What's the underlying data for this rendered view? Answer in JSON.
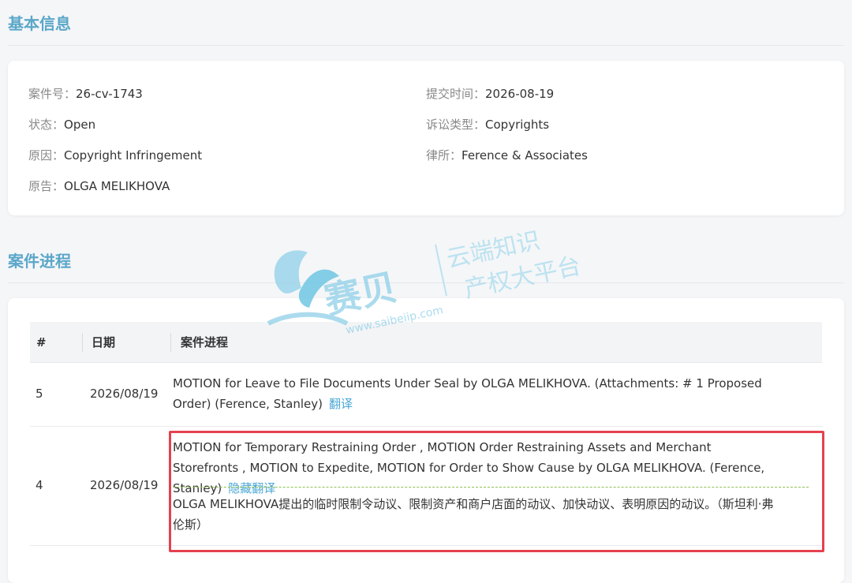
{
  "basic_info": {
    "title": "基本信息",
    "fields": [
      {
        "label": "案件号：",
        "value": "26-cv-1743"
      },
      {
        "label": "提交时间：",
        "value": "2026-08-19"
      },
      {
        "label": "状态：",
        "value": "Open"
      },
      {
        "label": "诉讼类型：",
        "value": "Copyrights"
      },
      {
        "label": "原因：",
        "value": "Copyright Infringement"
      },
      {
        "label": "律所：",
        "value": "Ference & Associates"
      },
      {
        "label": "原告：",
        "value": "OLGA MELIKHOVA"
      }
    ]
  },
  "progress": {
    "title": "案件进程",
    "columns": [
      "#",
      "日期",
      "案件进程"
    ],
    "rows": [
      {
        "num": "5",
        "date": "2026/08/19",
        "text": "MOTION for Leave to File Documents Under Seal by OLGA MELIKHOVA. (Attachments: # 1 Proposed Order) (Ference, Stanley)",
        "action": "翻译"
      },
      {
        "num": "4",
        "date": "2026/08/19",
        "text": "MOTION for Temporary Restraining Order , MOTION Order Restraining Assets and Merchant Storefronts , MOTION to Expedite, MOTION for Order to Show Cause by OLGA MELIKHOVA. (Ference, Stanley)",
        "action": "隐藏翻译",
        "translation": "OLGA MELIKHOVA提出的临时限制令动议、限制资产和商户店面的动议、加快动议、表明原因的动议。（斯坦利·弗伦斯）"
      }
    ]
  },
  "watermark": {
    "brand": "赛贝",
    "url": "www.saibeiip.com",
    "line1": "云端知识",
    "line2": "产权大平台"
  },
  "colors": {
    "accent": "#5ba7c9",
    "link": "#4aa7d6",
    "highlight": "#e5414f",
    "dashed": "#8cc152"
  }
}
